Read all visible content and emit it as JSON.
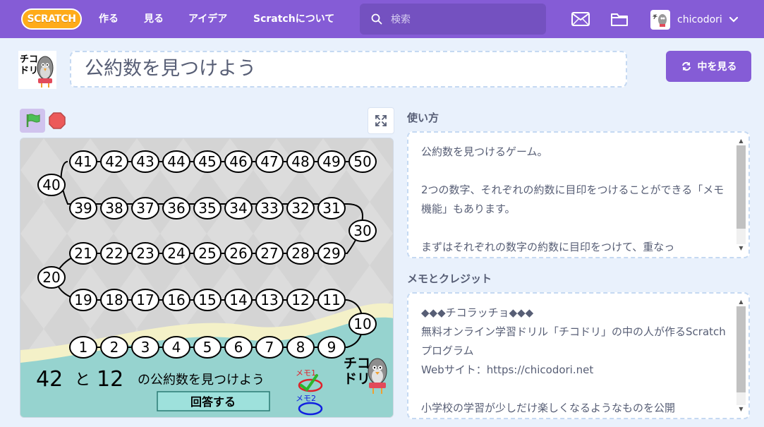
{
  "nav": {
    "logo": "SCRATCH",
    "items": [
      "作る",
      "見る",
      "アイデア",
      "Scratchについて"
    ],
    "search_placeholder": "検索",
    "username": "chicodori"
  },
  "project": {
    "title": "公約数を見つけよう",
    "see_inside_label": "中を見る"
  },
  "instructions": {
    "label": "使い方",
    "text": "公約数を見つけるゲーム。\n\n2つの数字、それぞれの約数に目印をつけることができる「メモ機能」もあります。\n\nまずはそれぞれの数字の約数に目印をつけて、重なっ"
  },
  "notes": {
    "label": "メモとクレジット",
    "text": "◆◆◆チコラッチョ◆◆◆\n無料オンライン学習ドリル「チコドリ」の中の人が作るScratchプログラム\nWebサイト：https://chicodori.net\n\n小学校の学習が少しだけ楽しくなるようなものを公開"
  },
  "stage": {
    "rows": [
      [
        41,
        42,
        43,
        44,
        45,
        46,
        47,
        48,
        49,
        50
      ],
      [
        39,
        38,
        37,
        36,
        35,
        34,
        33,
        32,
        31
      ],
      [
        21,
        22,
        23,
        24,
        25,
        26,
        27,
        28,
        29
      ],
      [
        19,
        18,
        17,
        16,
        15,
        14,
        13,
        12,
        11
      ],
      [
        1,
        2,
        3,
        4,
        5,
        6,
        7,
        8,
        9
      ]
    ],
    "turns": [
      40,
      30,
      20,
      10
    ],
    "num_a": "42",
    "and_label": "と",
    "num_b": "12",
    "prompt": "の公約数を見つけよう",
    "answer_button": "回答する",
    "memo1": "メモ1",
    "memo2": "メモ2",
    "logo_text": "チコドリ"
  },
  "colors": {
    "brand": "#855cd6",
    "stage_bg": "#d6d6d6",
    "answer_button": "#9ee1dc",
    "memo1": "#e0202a",
    "memo2": "#1020e0"
  }
}
